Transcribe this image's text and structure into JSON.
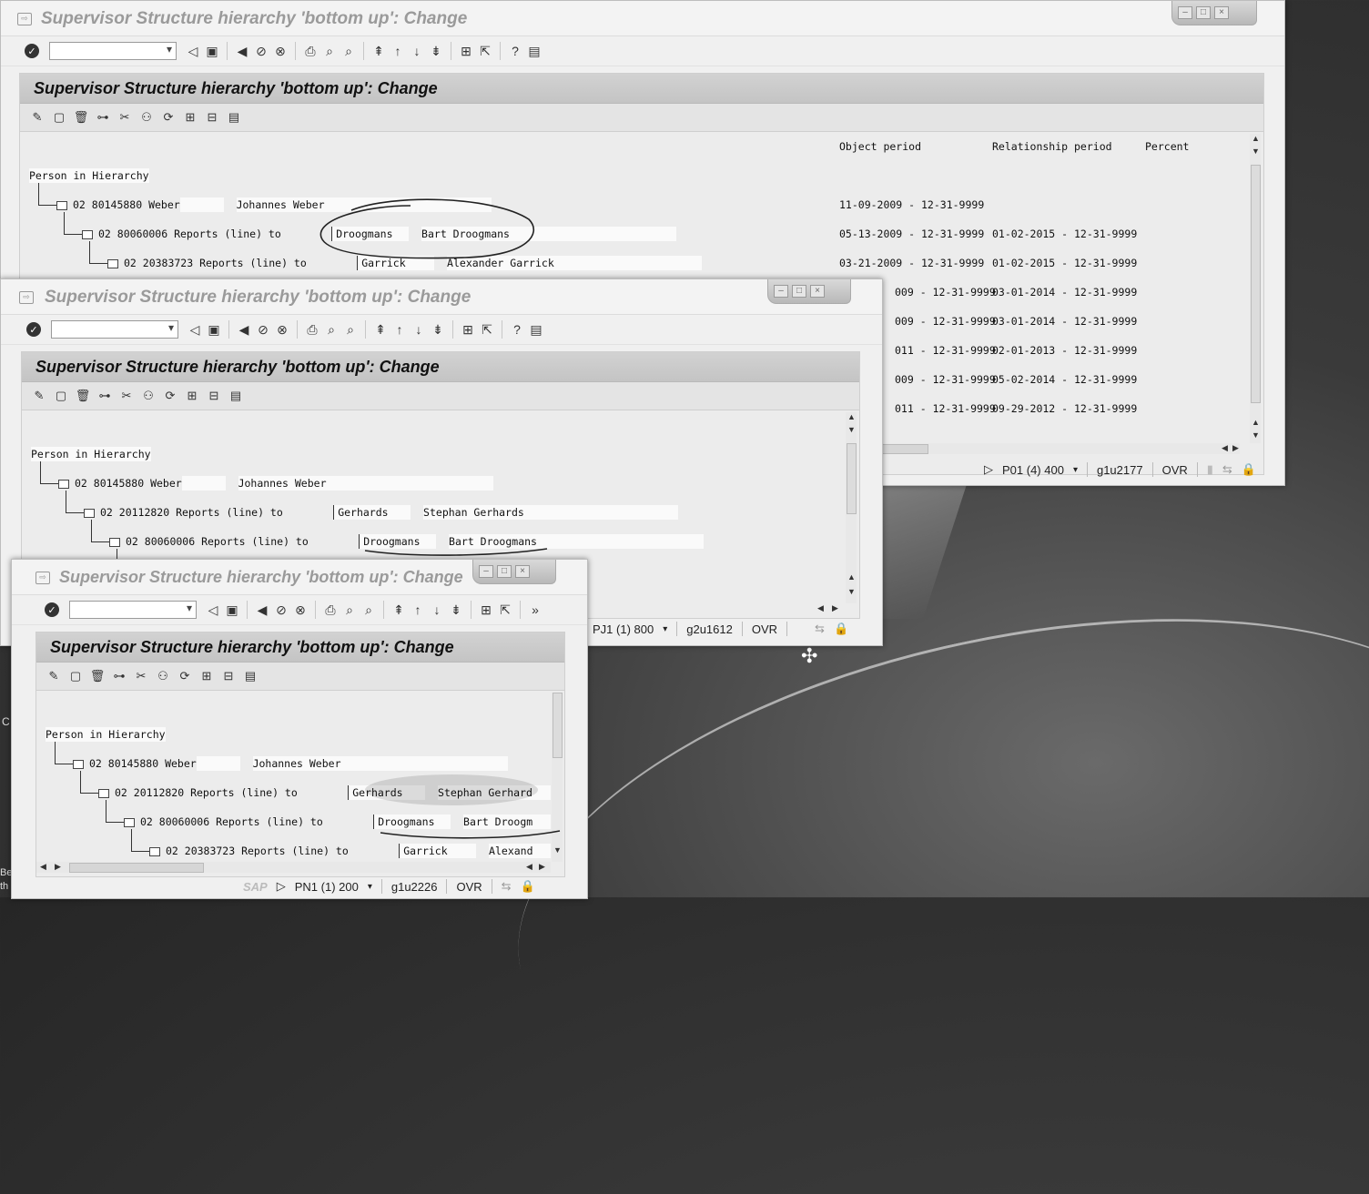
{
  "window_title": "Supervisor Structure hierarchy 'bottom up': Change",
  "panel_title": "Supervisor Structure hierarchy 'bottom up': Change",
  "tree_root": "Person in Hierarchy",
  "columns": {
    "object_period": "Object period",
    "relationship_period": "Relationship period",
    "percent": "Percent"
  },
  "win1": {
    "rows": [
      {
        "id": "02 80145880 Weber",
        "f1": "",
        "f2": "Johannes Weber",
        "obj": "11-09-2009 - 12-31-9999",
        "rel": ""
      },
      {
        "id": "02 80060006 Reports (line) to",
        "f1": "Droogmans",
        "f2": "Bart Droogmans",
        "obj": "05-13-2009 - 12-31-9999",
        "rel": "01-02-2015 - 12-31-9999"
      },
      {
        "id": "02 20383723 Reports (line) to",
        "f1": "Garrick",
        "f2": "Alexander Garrick",
        "obj": "03-21-2009 - 12-31-9999",
        "rel": "01-02-2015 - 12-31-9999"
      }
    ],
    "partial_rows": [
      {
        "obj": "009 - 12-31-9999",
        "rel": "03-01-2014 - 12-31-9999"
      },
      {
        "obj": "009 - 12-31-9999",
        "rel": "03-01-2014 - 12-31-9999"
      },
      {
        "obj": "011 - 12-31-9999",
        "rel": "02-01-2013 - 12-31-9999"
      },
      {
        "obj": "009 - 12-31-9999",
        "rel": "05-02-2014 - 12-31-9999"
      },
      {
        "obj": "011 - 12-31-9999",
        "rel": "09-29-2012 - 12-31-9999"
      }
    ],
    "status": {
      "system": "P01 (4) 400",
      "server": "g1u2177",
      "mode": "OVR"
    }
  },
  "win2": {
    "rows": [
      {
        "id": "02 80145880 Weber",
        "f1": "",
        "f2": "Johannes Weber"
      },
      {
        "id": "02 20112820 Reports (line) to",
        "f1": "Gerhards",
        "f2": "Stephan Gerhards"
      },
      {
        "id": "02 80060006 Reports (line) to",
        "f1": "Droogmans",
        "f2": "Bart Droogmans"
      }
    ],
    "status": {
      "system": "PJ1 (1) 800",
      "server": "g2u1612",
      "mode": "OVR"
    }
  },
  "win3": {
    "rows": [
      {
        "id": "02 80145880 Weber",
        "f1": "",
        "f2": "Johannes Weber"
      },
      {
        "id": "02 20112820 Reports (line) to",
        "f1": "Gerhards",
        "f2": "Stephan Gerhard"
      },
      {
        "id": "02 80060006 Reports (line) to",
        "f1": "Droogmans",
        "f2": "Bart Droogm"
      },
      {
        "id": "02 20383723 Reports (line) to",
        "f1": "Garrick",
        "f2": "Alexand"
      }
    ],
    "status": {
      "logo": "SAP",
      "system": "PN1 (1) 200",
      "server": "g1u2226",
      "mode": "OVR"
    }
  },
  "desktop": {
    "left_text": "Be th",
    "left_c": "C"
  },
  "colors": {
    "window_bg": "#f0f0f0",
    "panel_head": "#c8c8c8",
    "field_bg": "#fafafa"
  }
}
